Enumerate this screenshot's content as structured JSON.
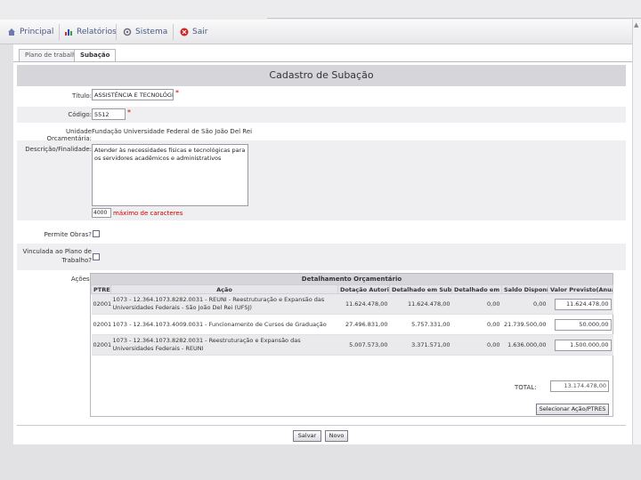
{
  "menu": {
    "principal": "Principal",
    "relatorios": "Relatórios",
    "sistema": "Sistema",
    "sair": "Sair"
  },
  "tabs": [
    "Plano de trabalho",
    "Subação"
  ],
  "page_title": "Cadastro de Subação",
  "form": {
    "titulo_label": "Título:",
    "titulo_value": "ASSISTÊNCIA E TECNOLÓGICO",
    "codigo_label": "Código:",
    "codigo_value": "5512",
    "unidade_label": "Unidade Orçamentária:",
    "unidade_value": "Fundação Universidade Federal de São João Del Rei",
    "descricao_label": "Descrição/Finalidade:",
    "descricao_value": "Atender às necessidades físicas e tecnológicas para os servidores acadêmicos e administrativos",
    "counter_value": "4000",
    "counter_note": "máximo de caracteres",
    "permite_label": "Permite Obras?",
    "vinculada_label": "Vinculada ao Plano de Trabalho?",
    "acoes_label": "Ações:"
  },
  "detail": {
    "title": "Detalhamento Orçamentário",
    "headers": [
      "PTRES",
      "Ação",
      "Dotação Autorizada",
      "Detalhado em Subação",
      "Detalhado em PI",
      "Saldo Disponível",
      "Valor Previsto(Anual)"
    ],
    "rows": [
      {
        "ptres": "02001",
        "acao": "1073 - 12.364.1073.8282.0031 - REUNI - Reestruturação e Expansão das Universidades Federais - São João Del Rei (UFSJ)",
        "dotacao": "11.624.478,00",
        "subacao": "11.624.478,00",
        "pi": "0,00",
        "saldo": "0,00",
        "valor": "11.624.478,00"
      },
      {
        "ptres": "02001",
        "acao": "1073 - 12.364.1073.4009.0031 - Funcionamento de Cursos de Graduação",
        "dotacao": "27.496.831,00",
        "subacao": "5.757.331,00",
        "pi": "0,00",
        "saldo": "21.739.500,00",
        "valor": "50.000,00"
      },
      {
        "ptres": "02001",
        "acao": "1073 - 12.364.1073.8282.0031 - Reestruturação e Expansão das Universidades Federais - REUNI",
        "dotacao": "5.007.573,00",
        "subacao": "3.371.571,00",
        "pi": "0,00",
        "saldo": "1.636.000,00",
        "valor": "1.500.000,00"
      }
    ],
    "total_label": "TOTAL:",
    "total_value": "13.174.478,00",
    "select_button": "Selecionar Ação/PTRES"
  },
  "buttons": {
    "salvar": "Salvar",
    "novo": "Novo"
  },
  "colors": {
    "menu_text": "#4a5a86",
    "required": "#cc0000",
    "link_value": "#2a44a8",
    "title_bar": "#d6d6da"
  }
}
